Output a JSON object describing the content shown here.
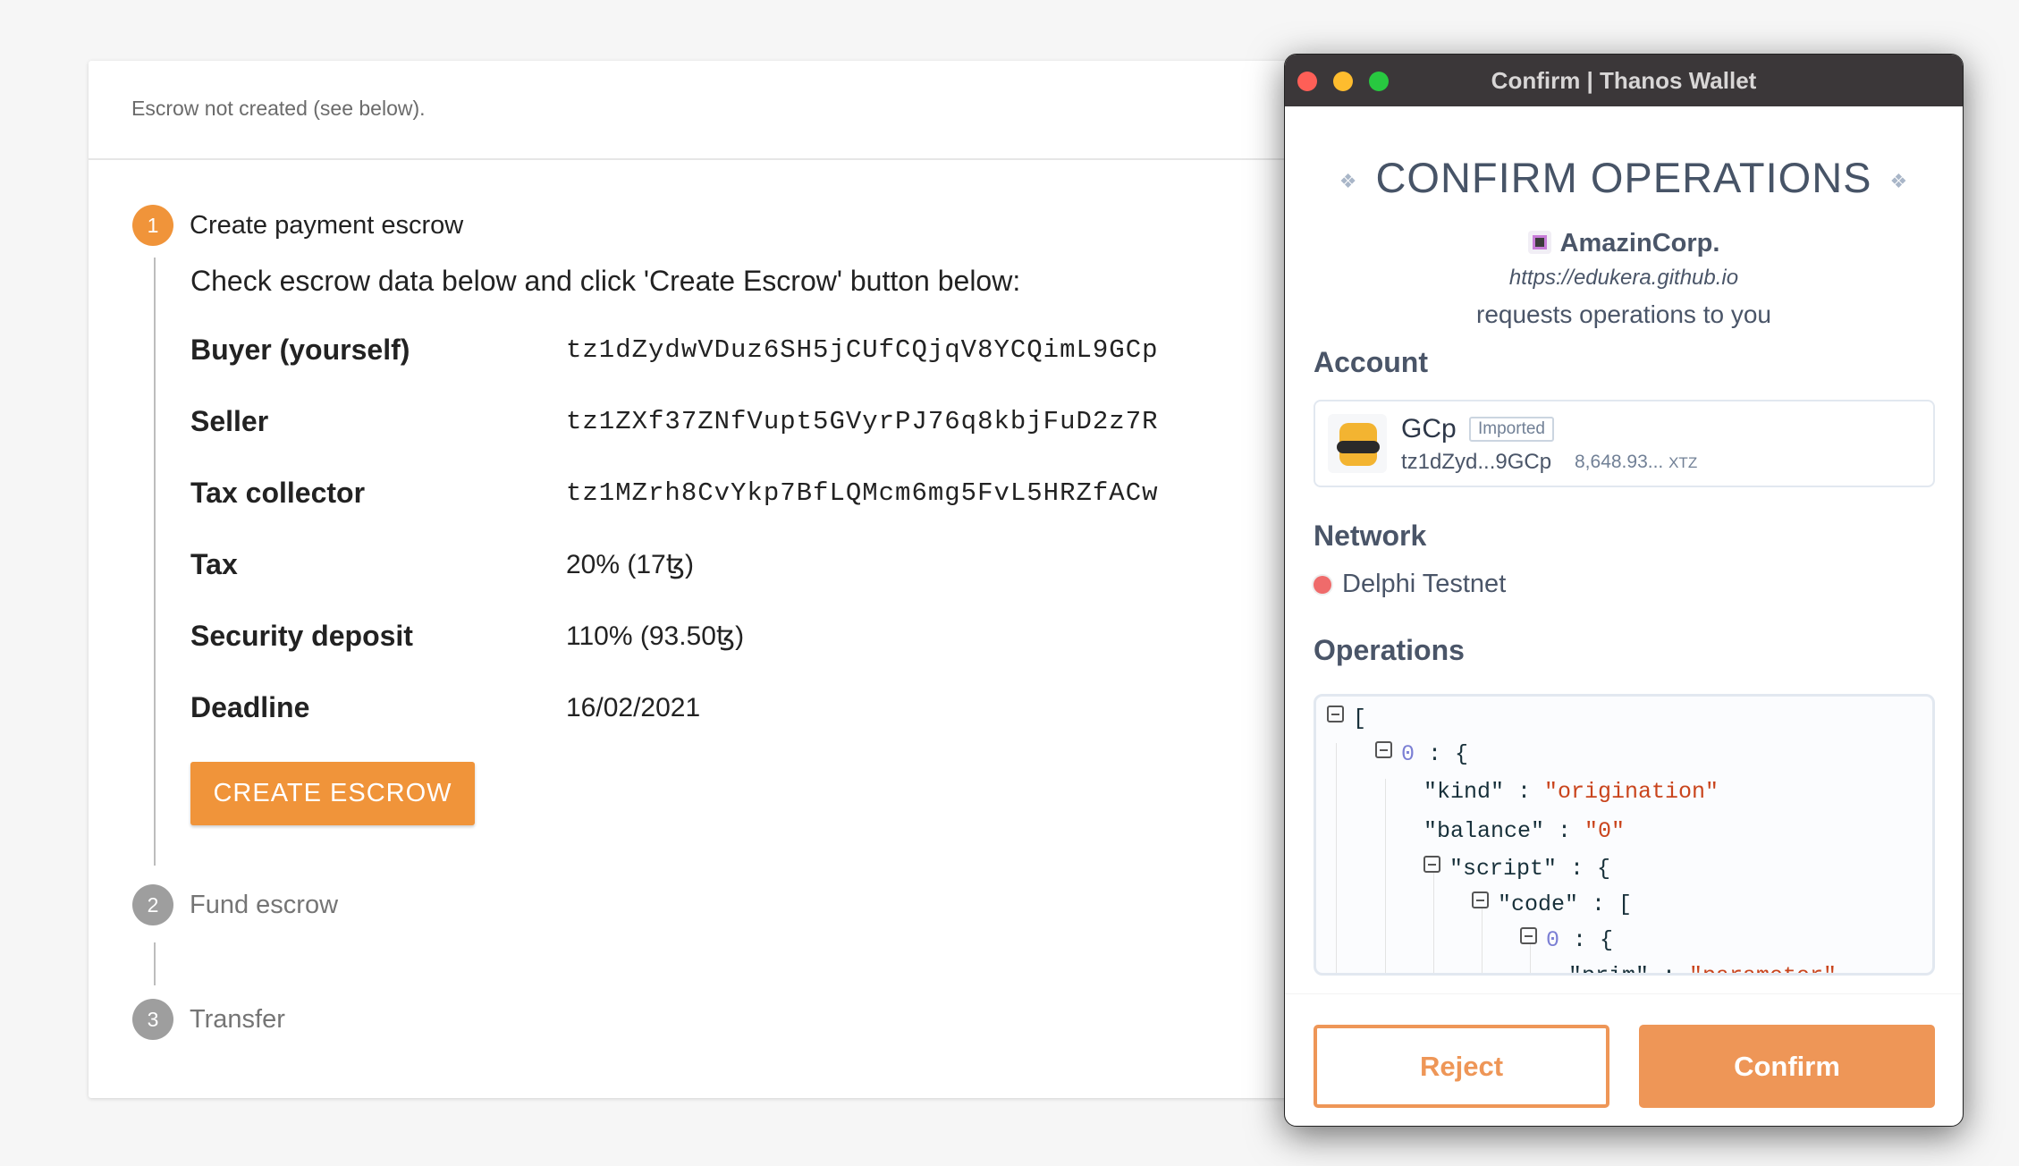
{
  "page": {
    "status": "Escrow not created (see below).",
    "steps": [
      {
        "number": "1",
        "label": "Create payment escrow"
      },
      {
        "number": "2",
        "label": "Fund escrow"
      },
      {
        "number": "3",
        "label": "Transfer"
      }
    ],
    "intro": "Check escrow data below and click 'Create Escrow' button below:",
    "rows": [
      {
        "label": "Buyer (yourself)",
        "value": "tz1dZydwVDuz6SH5jCUfCQjqV8YCQimL9GCp"
      },
      {
        "label": "Seller",
        "value": "tz1ZXf37ZNfVupt5GVyrPJ76q8kbjFuD2z7R"
      },
      {
        "label": "Tax collector",
        "value": "tz1MZrh8CvYkp7BfLQMcm6mg5FvL5HRZfACw"
      },
      {
        "label": "Tax",
        "value": "20% (17ꜩ)"
      },
      {
        "label": "Security deposit",
        "value": "110% (93.50ꜩ)"
      },
      {
        "label": "Deadline",
        "value": "16/02/2021"
      }
    ],
    "create_button": "CREATE ESCROW",
    "accent": "#f0943a"
  },
  "popup": {
    "window_title": "Confirm | Thanos Wallet",
    "title": "CONFIRM OPERATIONS",
    "app_name": "AmazinCorp.",
    "app_url": "https://edukera.github.io",
    "request_text": "requests operations to you",
    "account_heading": "Account",
    "account": {
      "name": "GCp",
      "badge": "Imported",
      "address": "tz1dZyd...9GCp",
      "balance": "8,648.93...",
      "unit": "XTZ"
    },
    "network_heading": "Network",
    "network": {
      "name": "Delphi Testnet",
      "color": "#ef6b6b"
    },
    "operations_heading": "Operations",
    "json": {
      "open_bracket": "[",
      "idx0": "0",
      "obj_open": " : {",
      "kind_key": "\"kind\" : ",
      "kind_val": "\"origination\"",
      "balance_key": "\"balance\" : ",
      "balance_val": "\"0\"",
      "script_key": "\"script\" : {",
      "code_key": "\"code\" : [",
      "idx1": "0",
      "prim_key": "\"prim\" : ",
      "prim_val": "\"parameter\""
    },
    "reject": "Reject",
    "confirm": "Confirm",
    "accent": "#ee9657"
  }
}
